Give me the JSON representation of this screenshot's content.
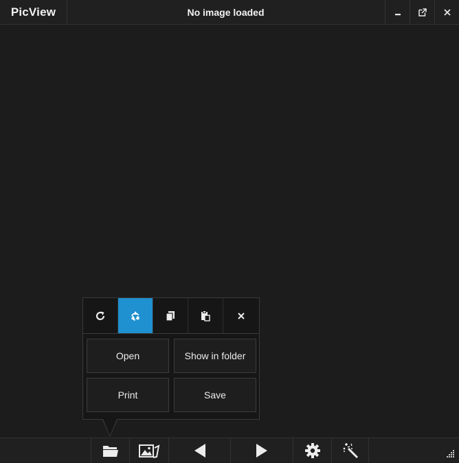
{
  "app": {
    "logo": "PicView",
    "title": "No image loaded"
  },
  "window_controls": [
    "minimize-icon",
    "restore-icon",
    "close-icon"
  ],
  "popup": {
    "icons": [
      {
        "name": "rotate-icon",
        "active": false
      },
      {
        "name": "recycle-icon",
        "active": true
      },
      {
        "name": "copy-icon",
        "active": false
      },
      {
        "name": "paste-icon",
        "active": false
      },
      {
        "name": "close-icon",
        "active": false
      }
    ],
    "buttons": {
      "open": "Open",
      "show_in_folder": "Show in folder",
      "print": "Print",
      "save": "Save"
    }
  },
  "toolbar": {
    "items": [
      "folder-icon",
      "gallery-icon",
      "previous-arrow-icon",
      "next-arrow-icon",
      "settings-gear-icon",
      "magic-wand-icon"
    ]
  },
  "colors": {
    "background": "#1b1b1b",
    "accent": "#1f90d0"
  }
}
